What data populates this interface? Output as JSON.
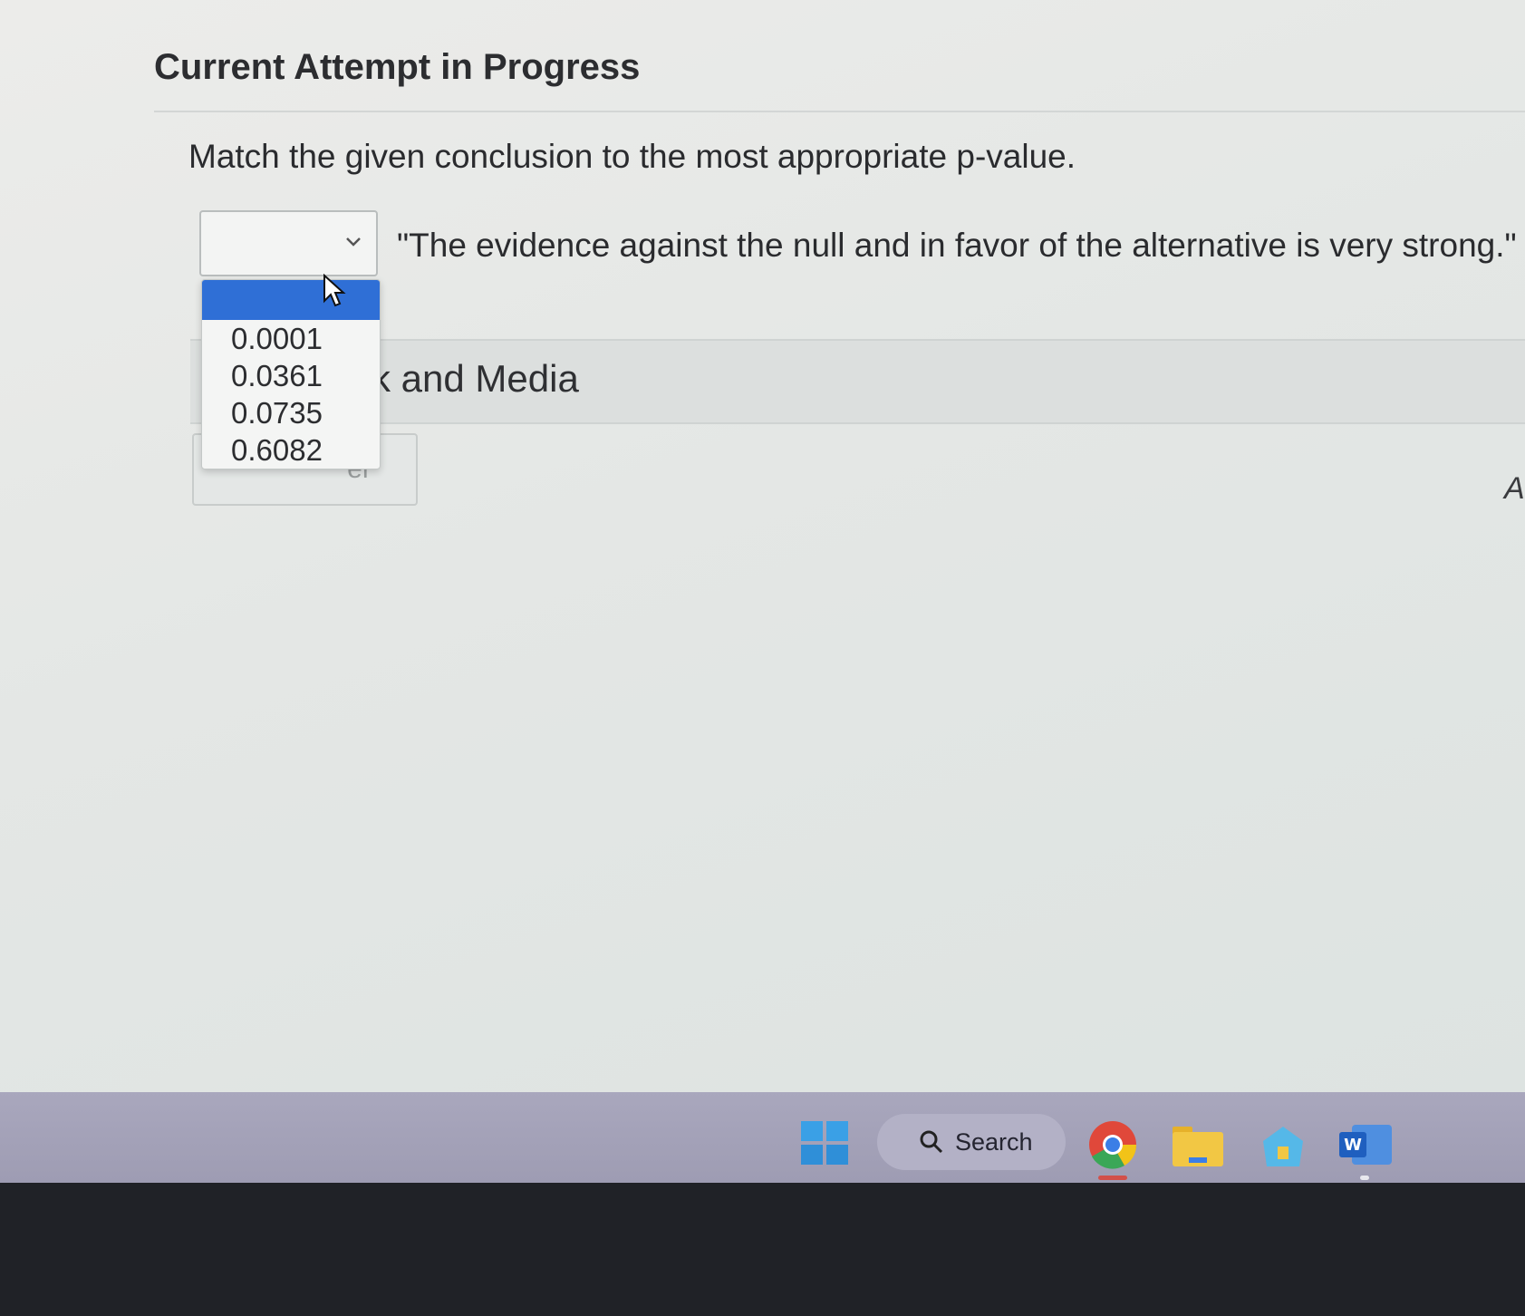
{
  "page": {
    "title": "Current Attempt in Progress"
  },
  "question": {
    "prompt": "Match the given conclusion to the most appropriate p-value.",
    "conclusion": "\"The evidence against the null and in favor of the alternative is very strong.\"",
    "selected_value": ""
  },
  "dropdown": {
    "options": [
      "0.0001",
      "0.0361",
      "0.0735",
      "0.6082"
    ]
  },
  "section": {
    "label_partial": "k and Media"
  },
  "buttons": {
    "save_partial": "er"
  },
  "edge": {
    "letter": "A"
  },
  "taskbar": {
    "search_label": "Search",
    "icons": [
      "windows-start-icon",
      "search-icon",
      "chrome-icon",
      "file-explorer-icon",
      "store-icon",
      "word-icon"
    ]
  },
  "colors": {
    "highlight": "#2f6fd6",
    "taskbar": "#a9a7bd"
  }
}
